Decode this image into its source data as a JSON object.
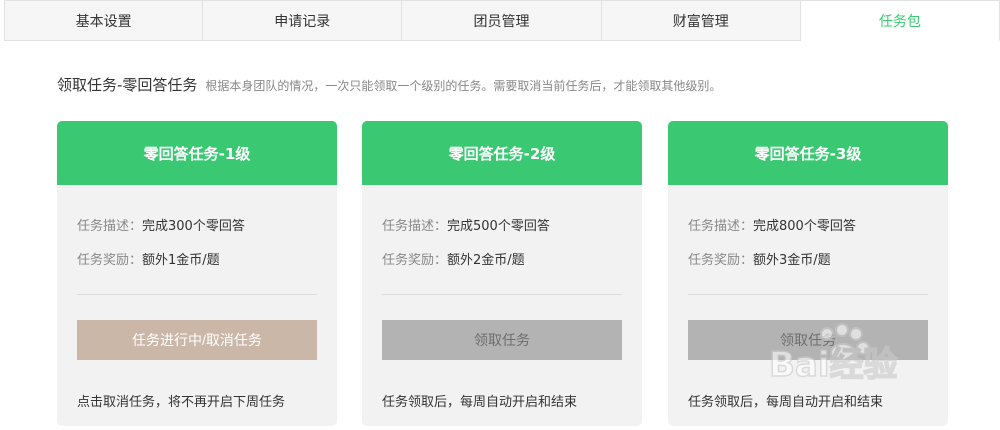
{
  "tabs": [
    {
      "label": "基本设置"
    },
    {
      "label": "申请记录"
    },
    {
      "label": "团员管理"
    },
    {
      "label": "财富管理"
    },
    {
      "label": "任务包",
      "active": true
    }
  ],
  "section": {
    "title": "领取任务-零回答任务",
    "note": "根据本身团队的情况，一次只能领取一个级别的任务。需要取消当前任务后，才能领取其他级别。"
  },
  "cards": [
    {
      "title": "零回答任务-1级",
      "desc_label": "任务描述：",
      "desc_value": "完成300个零回答",
      "reward_label": "任务奖励：",
      "reward_value": "额外1金币/题",
      "button": "任务进行中/取消任务",
      "footer": "点击取消任务，将不再开启下周任务"
    },
    {
      "title": "零回答任务-2级",
      "desc_label": "任务描述：",
      "desc_value": "完成500个零回答",
      "reward_label": "任务奖励：",
      "reward_value": "额外2金币/题",
      "button": "领取任务",
      "footer": "任务领取后，每周自动开启和结束"
    },
    {
      "title": "零回答任务-3级",
      "desc_label": "任务描述：",
      "desc_value": "完成800个零回答",
      "reward_label": "任务奖励：",
      "reward_value": "额外3金币/题",
      "button": "领取任务",
      "footer": "任务领取后，每周自动开启和结束"
    }
  ],
  "colors": {
    "accent": "#3bc872",
    "card_bg": "#f2f2f2",
    "cancel_button": "#cbb7a8",
    "claim_button": "#b3b3b3"
  },
  "watermark": {
    "text": "Bai经验",
    "icon": "baidu-paw-icon"
  }
}
